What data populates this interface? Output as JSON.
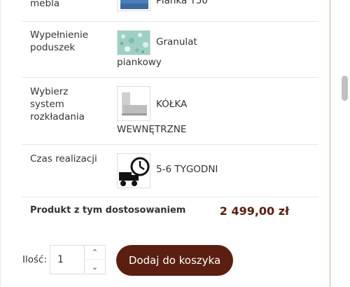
{
  "options": [
    {
      "label": "mebla",
      "value_line1": "Pianka T50",
      "value_line2": ""
    },
    {
      "label": "Wypełnienie\npoduszek",
      "value_line1": "Granulat",
      "value_line2": "piankowy"
    },
    {
      "label": "Wybierz\nsystem\nrozkładania",
      "value_line1": "KÓŁKA",
      "value_line2": "WEWNĘTRZNE"
    },
    {
      "label": "Czas realizacji",
      "value_line1": "5-6 TYGODNI",
      "value_line2": ""
    }
  ],
  "summary": {
    "label": "Produkt z tym dostosowaniem",
    "price": "2 499,00 zł"
  },
  "cart": {
    "qty_label": "Ilość:",
    "qty_value": "1",
    "add_button": "Dodaj do koszyka"
  },
  "colors": {
    "accent": "#5a1f10",
    "panel_border": "#9cc59a"
  }
}
